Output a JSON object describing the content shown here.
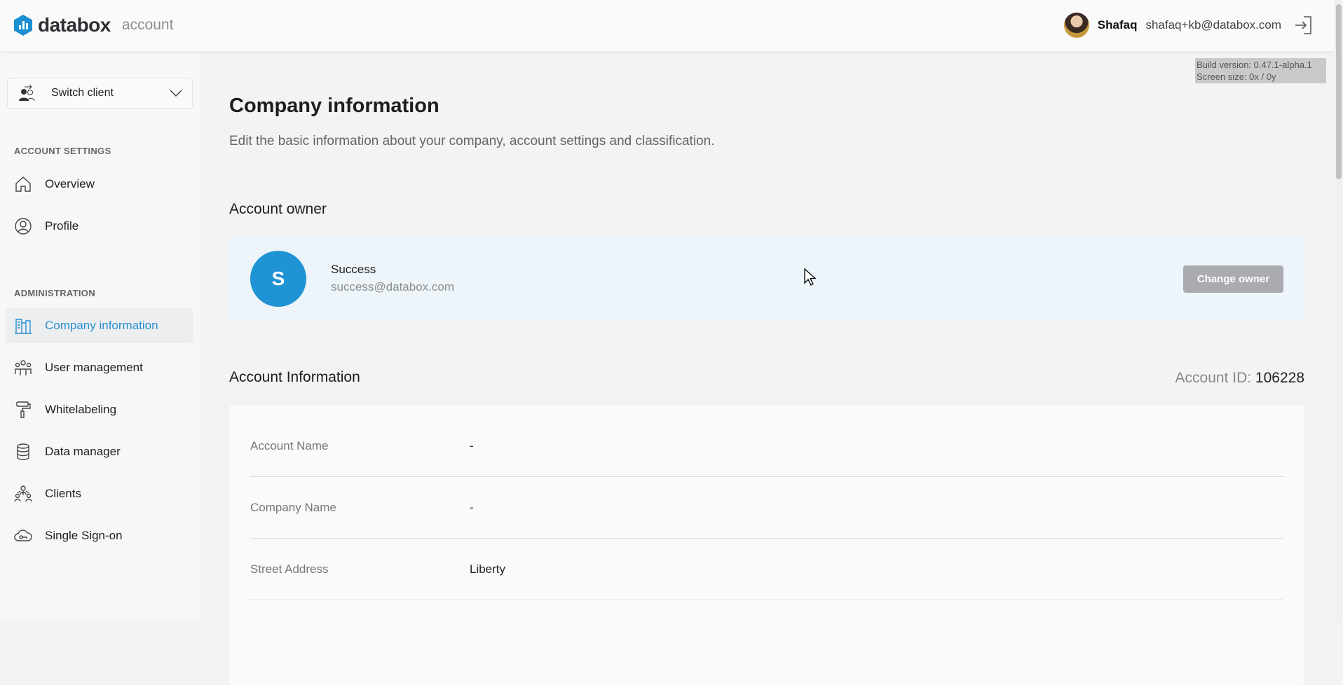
{
  "header": {
    "brand": "databox",
    "brand_sub": "account",
    "user_name": "Shafaq",
    "user_email": "shafaq+kb@databox.com"
  },
  "debug": {
    "build": "Build version: 0.47.1-alpha.1",
    "screen": "Screen size: 0x / 0y"
  },
  "sidebar": {
    "switch_client": "Switch client",
    "section_account": "ACCOUNT SETTINGS",
    "section_admin": "ADMINISTRATION",
    "items": [
      {
        "label": "Overview"
      },
      {
        "label": "Profile"
      },
      {
        "label": "Company information"
      },
      {
        "label": "User management"
      },
      {
        "label": "Whitelabeling"
      },
      {
        "label": "Data manager"
      },
      {
        "label": "Clients"
      },
      {
        "label": "Single Sign-on"
      }
    ]
  },
  "main": {
    "title": "Company information",
    "subtitle": "Edit the basic information about your company, account settings and classification.",
    "owner_heading": "Account owner",
    "owner": {
      "initial": "S",
      "name": "Success",
      "email": "success@databox.com",
      "button": "Change owner"
    },
    "info_heading": "Account Information",
    "account_id_label": "Account ID:",
    "account_id": "106228",
    "rows": [
      {
        "label": "Account Name",
        "value": "-"
      },
      {
        "label": "Company Name",
        "value": "-"
      },
      {
        "label": "Street Address",
        "value": "Liberty"
      }
    ]
  },
  "colors": {
    "accent": "#1f93d3",
    "button_disabled": "#a9abb0"
  }
}
